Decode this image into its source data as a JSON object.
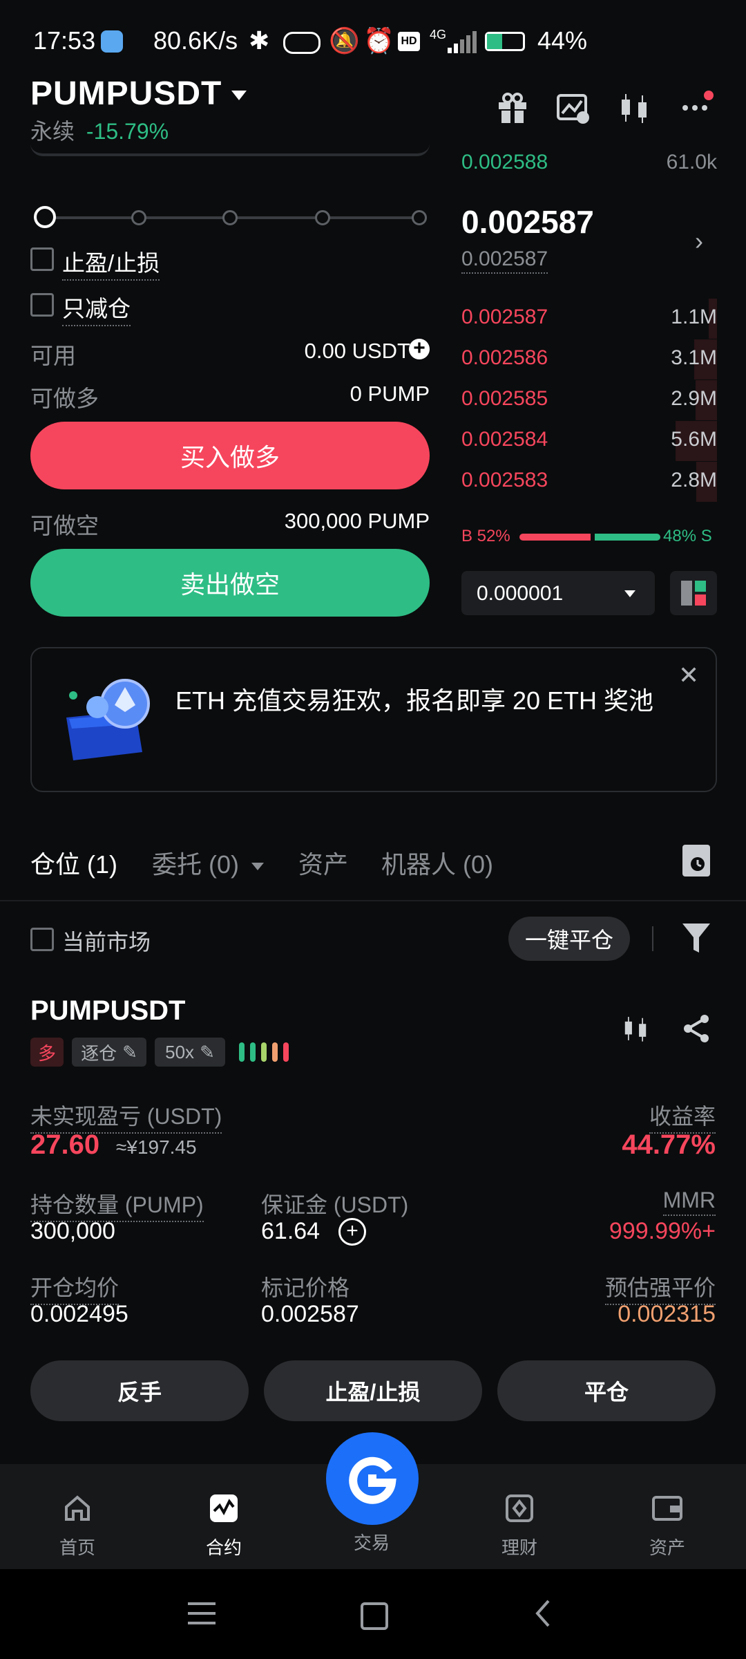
{
  "status_bar": {
    "time": "17:53",
    "speed": "80.6K/s",
    "network": "4G",
    "battery": "44%"
  },
  "header": {
    "symbol": "PUMPUSDT",
    "type": "永续",
    "change": "-15.79%"
  },
  "order_form": {
    "tp_sl_label": "止盈/止损",
    "reduce_only_label": "只减仓",
    "available_label": "可用",
    "available_value": "0.00 USDT",
    "can_long_label": "可做多",
    "can_long_value": "0 PUMP",
    "buy_long_label": "买入做多",
    "can_short_label": "可做空",
    "can_short_value": "300,000 PUMP",
    "sell_short_label": "卖出做空"
  },
  "order_book": {
    "top_row": {
      "price": "0.002588",
      "qty": "61.0k"
    },
    "last_price": "0.002587",
    "mark_price": "0.002587",
    "bids": [
      {
        "price": "0.002587",
        "qty": "1.1M"
      },
      {
        "price": "0.002586",
        "qty": "3.1M"
      },
      {
        "price": "0.002585",
        "qty": "2.9M"
      },
      {
        "price": "0.002584",
        "qty": "5.6M"
      },
      {
        "price": "0.002583",
        "qty": "2.8M"
      }
    ],
    "buy_ratio": "B 52%",
    "sell_ratio": "48% S",
    "buy_fraction": 0.52,
    "precision": "0.000001"
  },
  "banner": {
    "text": "ETH 充值交易狂欢，报名即享 20 ETH 奖池"
  },
  "tabs": [
    "仓位 (1)",
    "委托 (0)",
    "资产",
    "机器人 (0)"
  ],
  "filter": {
    "current_market": "当前市场",
    "close_all": "一键平仓"
  },
  "position": {
    "symbol": "PUMPUSDT",
    "side": "多",
    "margin_mode": "逐仓",
    "leverage": "50x",
    "pnl_label": "未实现盈亏 (USDT)",
    "pnl_value": "27.60",
    "pnl_cny": "≈¥197.45",
    "roe_label": "收益率",
    "roe_value": "44.77%",
    "size_label": "持仓数量 (PUMP)",
    "size_value": "300,000",
    "margin_label": "保证金 (USDT)",
    "margin_value": "61.64",
    "mmr_label": "MMR",
    "mmr_value": "999.99%+",
    "entry_label": "开仓均价",
    "entry_value": "0.002495",
    "mark_label": "标记价格",
    "mark_value": "0.002587",
    "liq_label": "预估强平价",
    "liq_value": "0.002315",
    "btn_reverse": "反手",
    "btn_tpsl": "止盈/止损",
    "btn_close": "平仓"
  },
  "nav": [
    "首页",
    "合约",
    "交易",
    "理财",
    "资产"
  ],
  "colors": {
    "green": "#2ebd85",
    "red": "#f6465d",
    "orange": "#f0a070",
    "accent": "#1c6ff8"
  }
}
